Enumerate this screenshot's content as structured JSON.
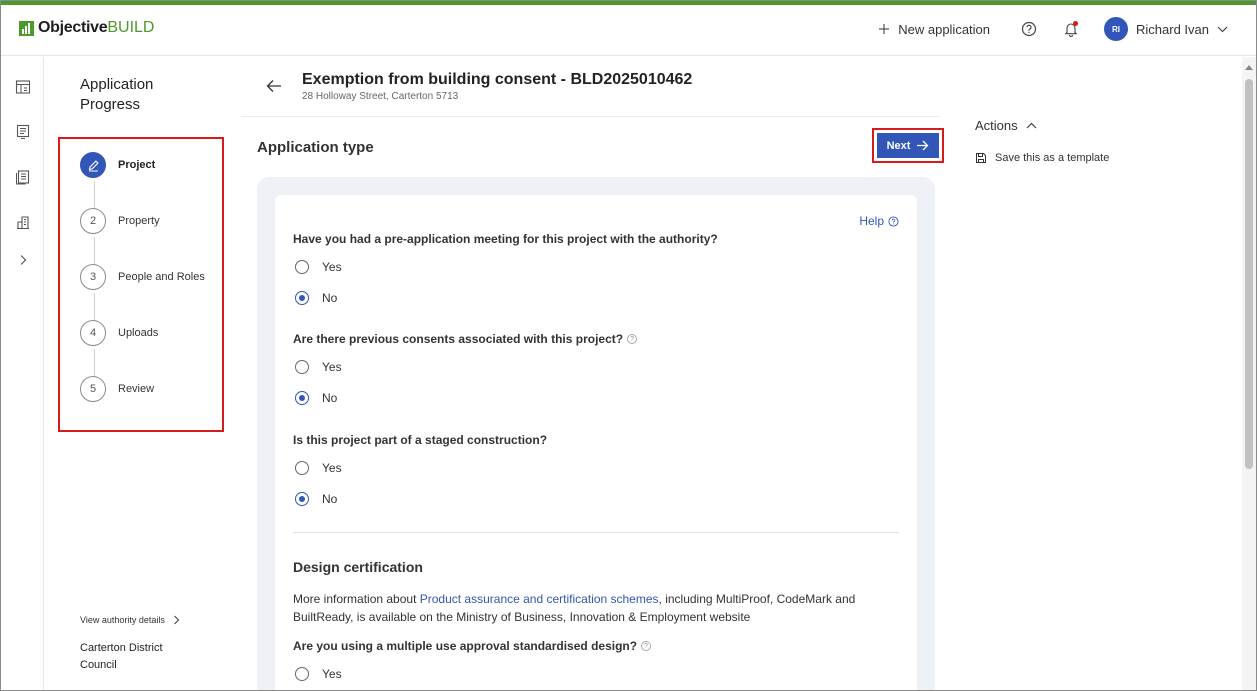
{
  "app": {
    "logo_main": "Objective",
    "logo_accent": "BUILD"
  },
  "header": {
    "new_application": "New application",
    "user_initials": "RI",
    "user_name": "Richard Ivan"
  },
  "progress": {
    "title": "Application Progress",
    "steps": [
      {
        "number": "1",
        "label": "Project",
        "state": "active"
      },
      {
        "number": "2",
        "label": "Property",
        "state": "pending"
      },
      {
        "number": "3",
        "label": "People and Roles",
        "state": "pending"
      },
      {
        "number": "4",
        "label": "Uploads",
        "state": "pending"
      },
      {
        "number": "5",
        "label": "Review",
        "state": "pending"
      }
    ],
    "authority_link": "View authority details",
    "authority_name": "Carterton District Council"
  },
  "page": {
    "title": "Exemption from building consent - BLD2025010462",
    "address": "28 Holloway Street, Carterton 5713",
    "section_title": "Application type",
    "next_label": "Next"
  },
  "form": {
    "help_label": "Help",
    "questions": [
      {
        "text": "Have you had a pre-application meeting for this project with the authority?",
        "has_help": false,
        "options": [
          "Yes",
          "No"
        ],
        "selected": "No"
      },
      {
        "text": "Are there previous consents associated with this project?",
        "has_help": true,
        "options": [
          "Yes",
          "No"
        ],
        "selected": "No"
      },
      {
        "text": "Is this project part of a staged construction?",
        "has_help": false,
        "options": [
          "Yes",
          "No"
        ],
        "selected": "No"
      }
    ],
    "design": {
      "title": "Design certification",
      "text_before": "More information about ",
      "link_text": "Product assurance and certification schemes",
      "text_after": ", including MultiProof, CodeMark and BuiltReady, is available on the Ministry of Business, Innovation & Employment website",
      "question": "Are you using a multiple use approval standardised design?",
      "option_yes": "Yes"
    }
  },
  "actions": {
    "title": "Actions",
    "save_template": "Save this as a template"
  },
  "colors": {
    "brand_green": "#4b9a2a",
    "primary_blue": "#3156b8",
    "highlight_red": "#d71a1a"
  }
}
